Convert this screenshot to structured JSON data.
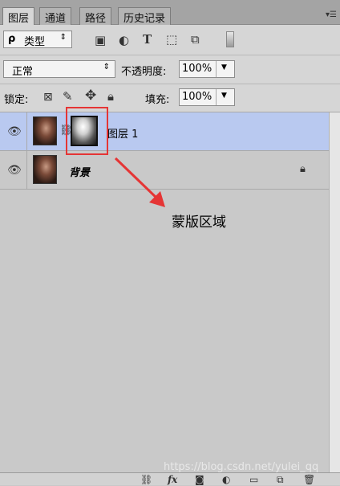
{
  "tabs": [
    {
      "label": "图层",
      "active": true
    },
    {
      "label": "通道",
      "active": false
    },
    {
      "label": "路径",
      "active": false
    },
    {
      "label": "历史记录",
      "active": false
    }
  ],
  "filter": {
    "search_glyph": "ρ",
    "kind": "类型"
  },
  "blend": {
    "mode": "正常",
    "opacity_label": "不透明度:",
    "opacity": "100%"
  },
  "lock": {
    "label": "锁定:",
    "fill_label": "填充:",
    "fill": "100%"
  },
  "layers": [
    {
      "name": "图层 1",
      "selected": true,
      "has_mask": true
    },
    {
      "name": "背景",
      "selected": false,
      "locked": true
    }
  ],
  "annotation": {
    "text": "蒙版区域",
    "color": "#e53535"
  },
  "watermark": "https://blog.csdn.net/yulei_qq",
  "colors": {
    "selected_row": "#b9c9f0",
    "panel_bg": "#c9c9c9",
    "accent_red": "#e53535"
  }
}
